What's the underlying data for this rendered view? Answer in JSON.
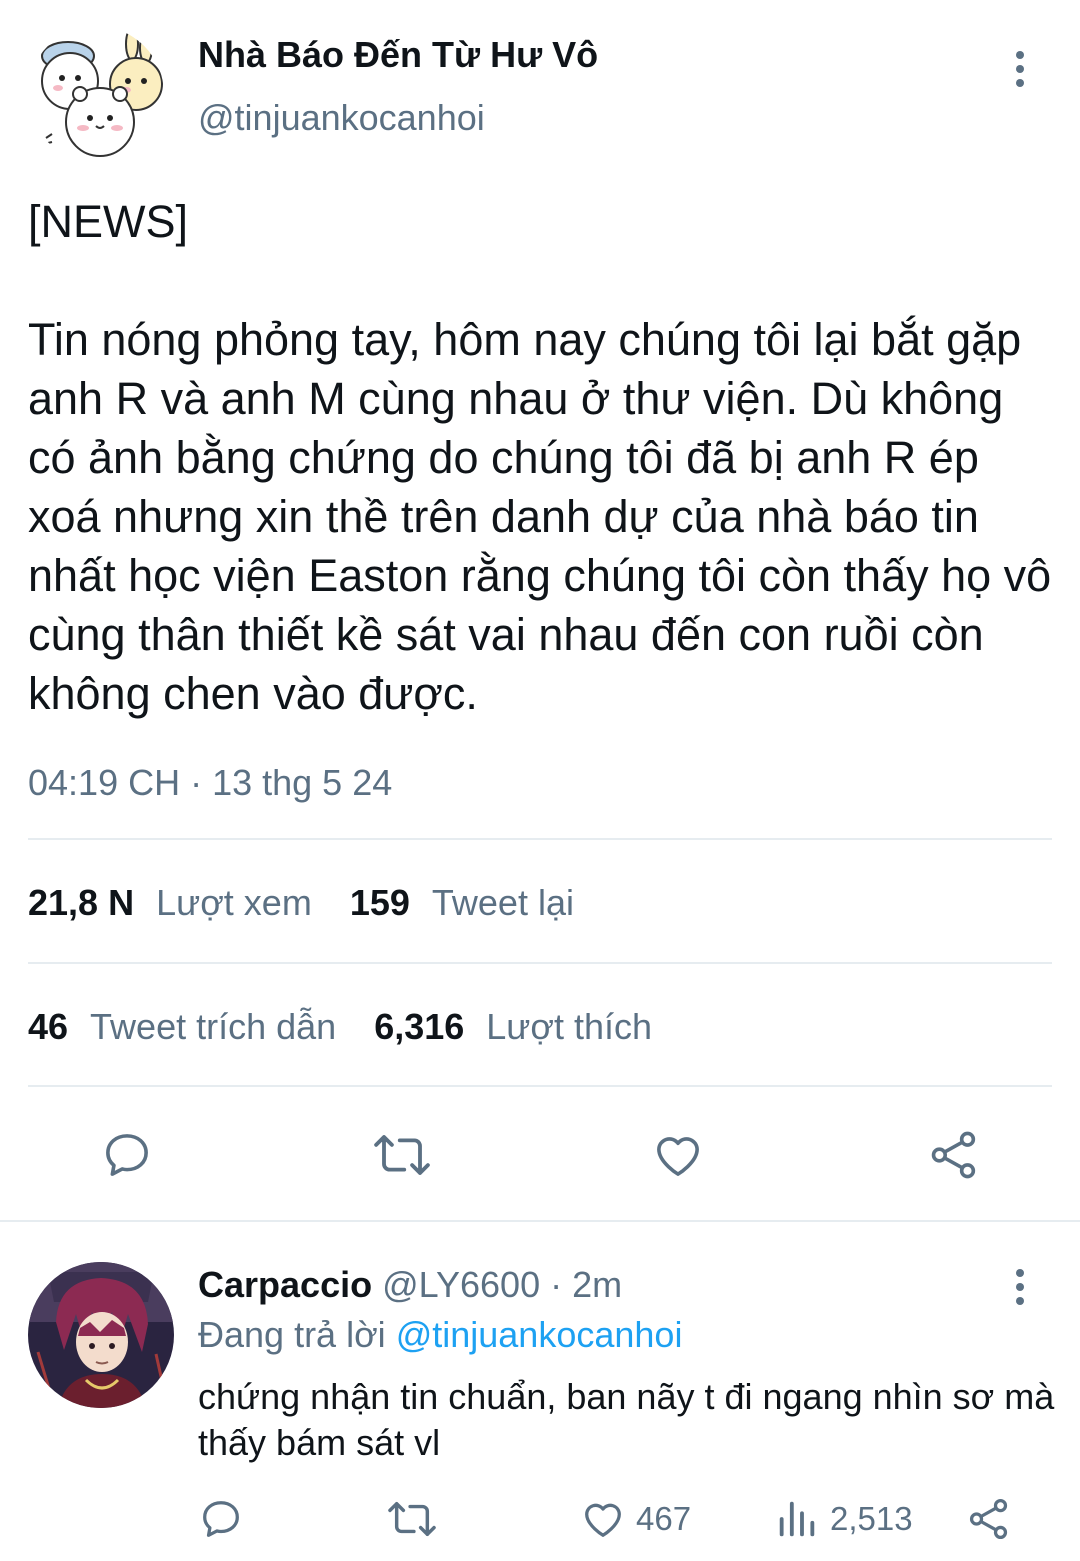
{
  "tweet": {
    "author_name": "Nhà Báo Đến Từ Hư Vô",
    "author_handle": "@tinjuankocanhoi",
    "text": "[NEWS]\n\nTin nóng phỏng tay, hôm nay chúng tôi lại bắt gặp anh R và anh M cùng nhau ở thư viện. Dù không có ảnh bằng chứng do chúng tôi đã bị anh R ép xoá nhưng xin thề trên danh dự của nhà báo tin nhất học viện Easton rằng chúng tôi còn thấy họ vô cùng thân thiết kề sát vai nhau đến con ruồi còn không chen vào được.",
    "timestamp": "04:19 CH · 13 thg 5 24",
    "stats": {
      "views_count": "21,8 N",
      "views_label": "Lượt xem",
      "retweets_count": "159",
      "retweets_label": "Tweet lại",
      "quotes_count": "46",
      "quotes_label": "Tweet trích dẫn",
      "likes_count": "6,316",
      "likes_label": "Lượt thích"
    },
    "actions": [
      "reply-icon",
      "retweet-icon",
      "like-icon",
      "share-icon"
    ]
  },
  "reply": {
    "author_name": "Carpaccio",
    "author_handle": "@LY6600",
    "separator": " · ",
    "time": "2m",
    "replying_prefix": "Đang trả lời",
    "replying_to": "@tinjuankocanhoi",
    "text": "chứng nhận tin chuẩn, ban nãy t đi ngang nhìn sơ mà thấy bám sát vl",
    "like_count": "467",
    "views_count": "2,513"
  },
  "colors": {
    "text_primary": "#0f1419",
    "text_secondary": "#5b7083",
    "link": "#1da1f2",
    "divider": "#e6ecf0"
  }
}
